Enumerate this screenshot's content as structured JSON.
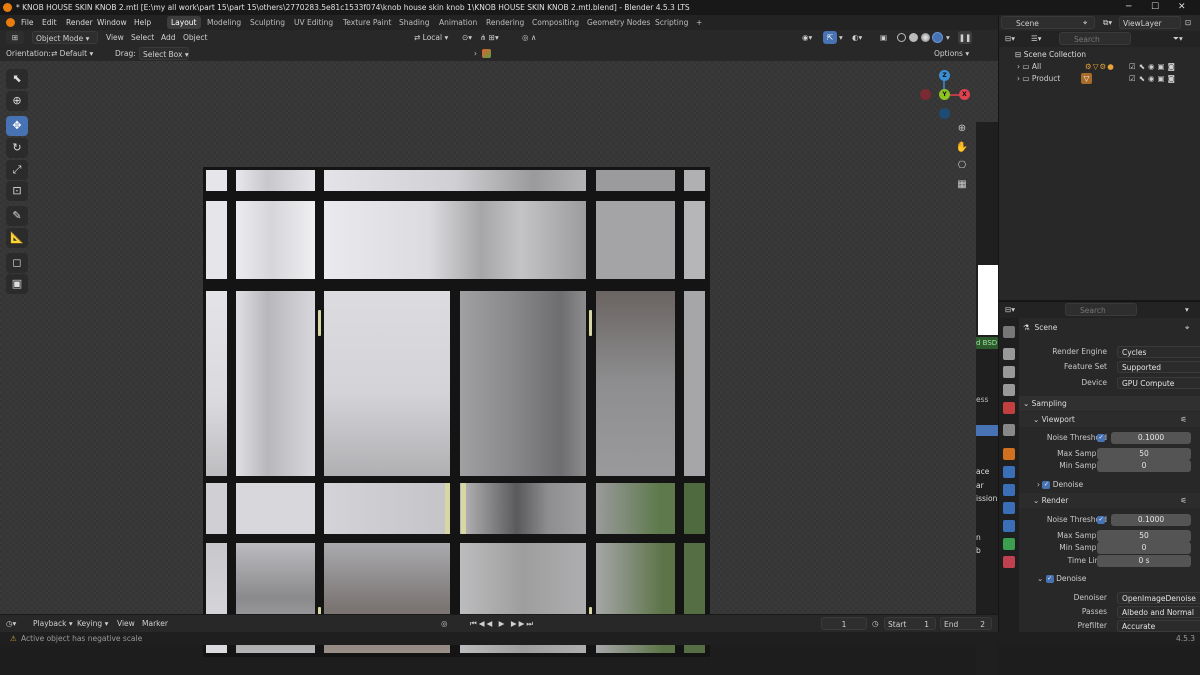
{
  "window": {
    "title": "* KNOB HOUSE SKIN KNOB 2.mtl [E:\\my all work\\part 15\\part 15\\others\\2770283.5e81c1533f074\\knob house skin knob 1\\KNOB HOUSE SKIN KNOB 2.mtl.blend] - Blender 4.5.3 LTS"
  },
  "menus": [
    "File",
    "Edit",
    "Render",
    "Window",
    "Help"
  ],
  "workspaces": [
    "Layout",
    "Modeling",
    "Sculpting",
    "UV Editing",
    "Texture Paint",
    "Shading",
    "Animation",
    "Rendering",
    "Compositing",
    "Geometry Nodes",
    "Scripting"
  ],
  "active_workspace": "Layout",
  "add_workspace": "+",
  "scene_selector": {
    "scene": "Scene",
    "view_layer": "ViewLayer"
  },
  "viewport_header": {
    "mode": "Object Mode",
    "menus": [
      "View",
      "Select",
      "Add",
      "Object"
    ],
    "transform": "Local",
    "orientation_label": "Orientation:",
    "orientation_value": "Default",
    "drag_label": "Drag:",
    "drag_value": "Select Box",
    "options": "Options"
  },
  "gizmo": {
    "x": "X",
    "y": "Y",
    "z": "Z"
  },
  "timeline": {
    "menus": [
      "Playback",
      "Keying",
      "View",
      "Marker"
    ],
    "current_frame": "1",
    "start_label": "Start",
    "start": "1",
    "end_label": "End",
    "end": "2"
  },
  "status": {
    "message": "Active object has negative scale",
    "version": "4.5.3"
  },
  "outliner": {
    "search_placeholder": "Search",
    "collection": "Scene Collection",
    "items": [
      {
        "name": "All"
      },
      {
        "name": "Product"
      }
    ]
  },
  "properties": {
    "search_placeholder": "Search",
    "context": "Scene",
    "rows": {
      "render_engine": {
        "label": "Render Engine",
        "value": "Cycles"
      },
      "feature_set": {
        "label": "Feature Set",
        "value": "Supported"
      },
      "device": {
        "label": "Device",
        "value": "GPU Compute"
      }
    },
    "sampling": "Sampling",
    "viewport": {
      "title": "Viewport",
      "noise_label": "Noise Threshold",
      "noise": "0.1000",
      "max_label": "Max Samples",
      "max": "50",
      "min_label": "Min Samples",
      "min": "0",
      "denoise": "Denoise"
    },
    "render": {
      "title": "Render",
      "noise_label": "Noise Threshold",
      "noise": "0.1000",
      "max_label": "Max Samples",
      "max": "50",
      "min_label": "Min Samples",
      "min": "0",
      "time_label": "Time Limit",
      "time": "0 s"
    },
    "denoise": {
      "title": "Denoise",
      "denoiser_label": "Denoiser",
      "denoiser": "OpenImageDenoise",
      "passes_label": "Passes",
      "passes": "Albedo and Normal",
      "prefilter_label": "Prefilter",
      "prefilter": "Accurate"
    }
  },
  "side_fragments": {
    "bsd": "d BSD",
    "ess": "ess",
    "ace": "ace",
    "ar": "ar",
    "ission": "ission",
    "n": "n",
    "b": "b"
  },
  "colors": {
    "accent": "#4772b3",
    "x_axis": "#e0414f",
    "y_axis": "#8cc320",
    "z_axis": "#3b8fd6",
    "handle": "#d8d6a2"
  }
}
